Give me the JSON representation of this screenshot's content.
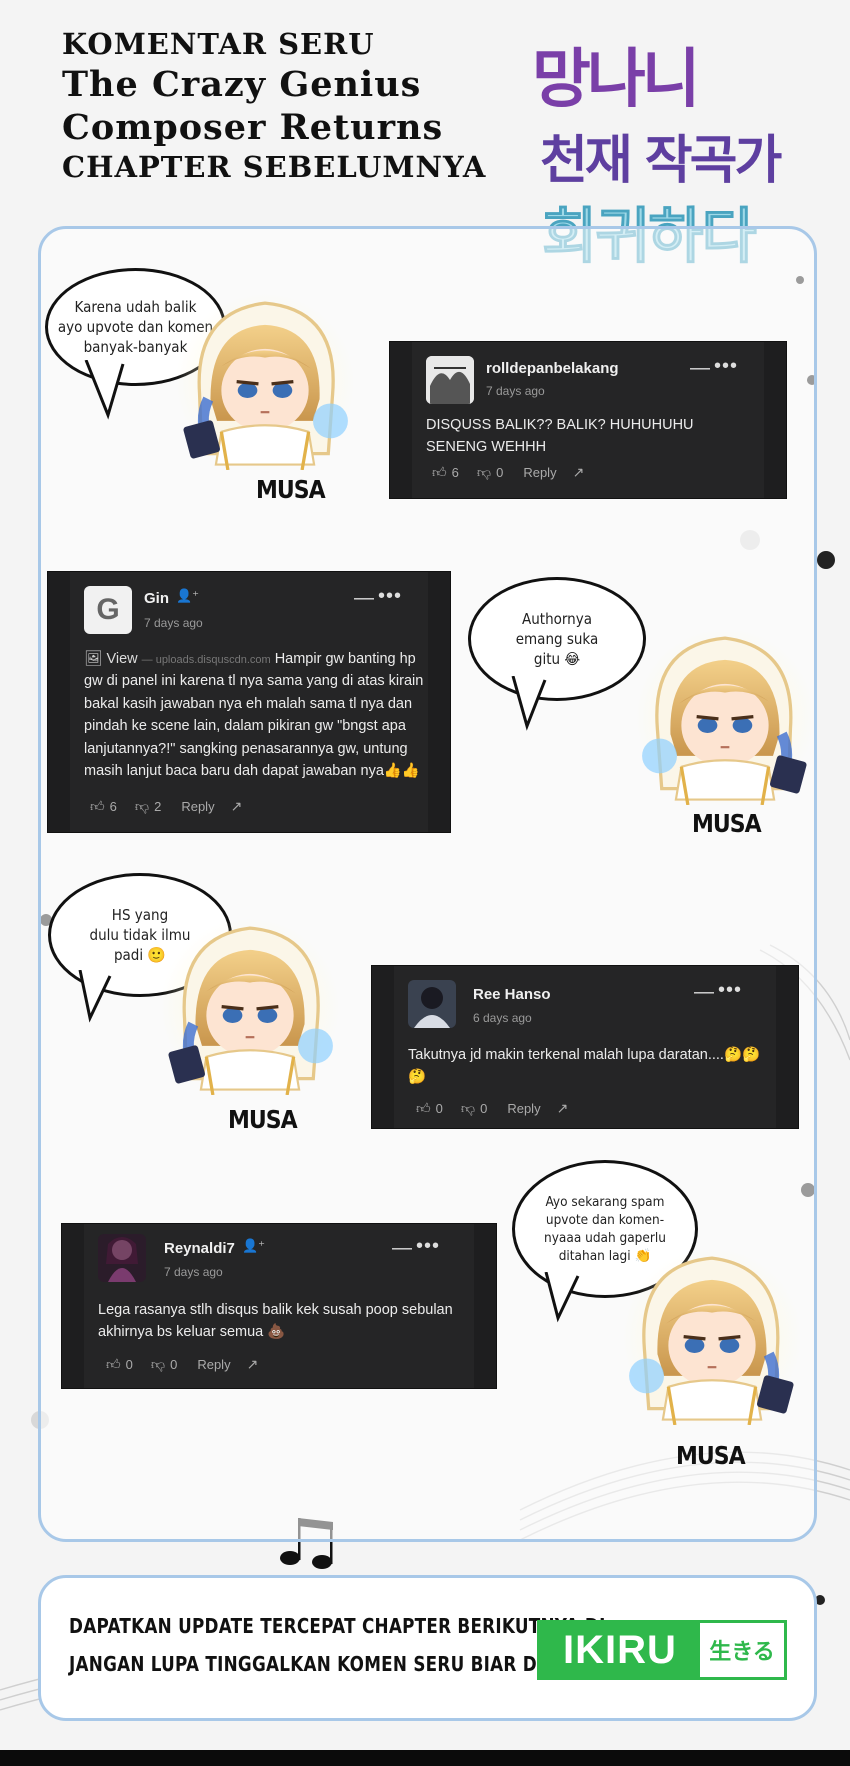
{
  "header": {
    "line1": "KOMENTAR SERU",
    "line2": "The Crazy Genius",
    "line3": "Composer Returns",
    "line4": "CHAPTER SEBELUMNYA"
  },
  "logo": {
    "row1": "망나니",
    "row2": "천재 작곡가",
    "row3": "회귀하다"
  },
  "character_label": "MUSA",
  "bubbles": [
    {
      "text": "Karena udah balik\nayo upvote dan komen\nbanyak-banyak"
    },
    {
      "text": "Authornya\nemang suka\ngitu 😂"
    },
    {
      "text": "HS yang\ndulu tidak ilmu\npadi 🙂"
    },
    {
      "text": "Ayo sekarang spam\nupvote dan komen-\nnyaaa udah gaperlu\nditahan lagi 👏"
    }
  ],
  "comments": [
    {
      "username": "rolldepanbelakang",
      "date": "7 days ago",
      "text": "DISQUSS BALIK?? BALIK? HUHUHUHU SENENG WEHHH",
      "upvotes": "6",
      "downvotes": "0",
      "reply": "Reply",
      "menu_dash": "—",
      "menu_dots": "•••"
    },
    {
      "username": "Gin",
      "avatar_letter": "G",
      "date": "7 days ago",
      "view_label": "View",
      "view_source": "— uploads.disquscdn.com",
      "text": "Hampir gw banting hp gw di panel ini karena tl nya sama yang di atas kirain bakal kasih jawaban nya eh malah sama tl nya dan pindah ke scene lain, dalam pikiran gw \"bngst apa lanjutannya?!\" sangking penasarannya gw, untung masih lanjut baca baru dah dapat jawaban nya👍👍",
      "upvotes": "6",
      "downvotes": "2",
      "reply": "Reply",
      "menu_dash": "—",
      "menu_dots": "•••"
    },
    {
      "username": "Ree Hanso",
      "date": "6 days ago",
      "text": "Takutnya jd makin terkenal malah lupa daratan....🤔🤔🤔",
      "upvotes": "0",
      "downvotes": "0",
      "reply": "Reply",
      "menu_dash": "—",
      "menu_dots": "•••"
    },
    {
      "username": "Reynaldi7",
      "date": "7 days ago",
      "text": "Lega rasanya stlh disqus balik kek susah poop sebulan akhirnya bs keluar semua 💩",
      "upvotes": "0",
      "downvotes": "0",
      "reply": "Reply",
      "menu_dash": "—",
      "menu_dots": "•••"
    }
  ],
  "banner": {
    "line1": "DAPATKAN UPDATE TERCEPAT CHAPTER BERIKUTNYA DI",
    "line2": "JANGAN LUPA TINGGALKAN KOMEN SERU BIAR DI NOTIS",
    "brand": "IKIRU",
    "brand_jp": "生きる"
  },
  "colors": {
    "panel_border": "#a8c8e8",
    "card_bg": "#1e1e1f",
    "brand_green": "#2fb84b"
  }
}
